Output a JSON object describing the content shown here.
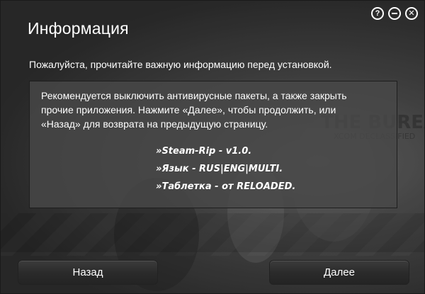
{
  "window": {
    "title": "Информация",
    "controls": [
      {
        "name": "help",
        "glyph": "?"
      },
      {
        "name": "minimize",
        "glyph": "–"
      },
      {
        "name": "close",
        "glyph": "✕"
      }
    ]
  },
  "subtitle": "Пожалуйста, прочитайте важную информацию перед установкой.",
  "info": {
    "lines": [
      "Рекомендуется выключить антивирусные пакеты, а также закрыть",
      "прочие приложения. Нажмите «Далее», чтобы продолжить, или",
      "«Назад» для возврата на предыдущую страницу."
    ],
    "bullets": [
      "»Steam-Rip - v1.0.",
      "»Язык - RUS|ENG|MULTI.",
      "»Таблетка - от RELOADED."
    ]
  },
  "buttons": {
    "back_label": "Назад",
    "next_label": "Далее"
  },
  "background": {
    "game_logo_text": "THE BUREAU",
    "game_logo_sub": "XCOM DECLASSIFIED"
  }
}
